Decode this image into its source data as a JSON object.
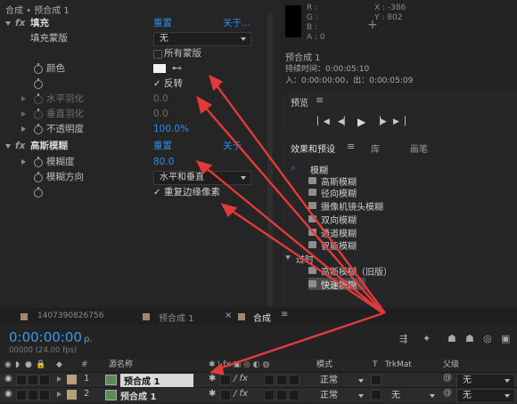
{
  "header": {
    "title": "合成 • 预合成 1"
  },
  "effects": {
    "fill": {
      "fx": "fx",
      "name": "填充",
      "reset": "重置",
      "about": "关于..."
    },
    "fill_mask": {
      "label": "填充蒙版",
      "value": "无"
    },
    "all_masks": {
      "label": "所有蒙版"
    },
    "color": {
      "label": "颜色"
    },
    "invert": {
      "check": "✓",
      "label": "反转"
    },
    "h_feather": {
      "label": "水平羽化",
      "value": "0.0"
    },
    "v_feather": {
      "label": "垂直羽化",
      "value": "0.0"
    },
    "opacity": {
      "label": "不透明度",
      "value": "100.0%"
    },
    "blur": {
      "fx": "fx",
      "name": "高斯模糊",
      "reset": "重置",
      "about": "关于"
    },
    "blurriness": {
      "label": "模糊度",
      "value": "80.0"
    },
    "blur_dir": {
      "label": "模糊方向",
      "value": "水平和垂直"
    },
    "repeat_edge": {
      "check": "✓",
      "label": "重复边缘像素"
    }
  },
  "info": {
    "r": "R :",
    "g": "G :",
    "b": "B :",
    "a": "A : 0",
    "x": "X : -386",
    "y": "Y : 802",
    "plus": "+",
    "comp_name": "预合成 1",
    "duration": "持续时间：0:00:05:10",
    "inout": "入：0:00:00:00，出：0:00:05:09"
  },
  "preview": {
    "title": "预览",
    "menu": "≡"
  },
  "effects_presets": {
    "tabs": [
      "效果和预设",
      "≡",
      "库",
      "画笔"
    ],
    "search_value": "模糊",
    "items": [
      "高斯模糊",
      "径向模糊",
      "摄像机镜头模糊",
      "双向模糊",
      "通道模糊",
      "智能模糊"
    ],
    "folder": "过时",
    "folder_items": [
      "高斯模糊（旧版）",
      "快速模糊"
    ]
  },
  "timeline": {
    "tabs": [
      "1407390826756",
      "预合成 1",
      "×",
      "合成",
      "≡"
    ],
    "timecode": "0:00:00:00",
    "fps": "00000 (24.00 fps)",
    "search_placeholder": "ρ.",
    "col_num": "#",
    "col_source": "源名称",
    "col_mode": "模式",
    "col_t": "T",
    "col_trkmat": "TrkMat",
    "col_parent": "父级",
    "layers": [
      {
        "num": "1",
        "name": "预合成 1",
        "mode": "正常",
        "trkmat": "",
        "parent": "无"
      },
      {
        "num": "2",
        "name": "预合成 1",
        "mode": "正常",
        "trkmat": "无",
        "parent": "无"
      }
    ]
  },
  "colors": {
    "accent": "#2d8ceb",
    "arrow": "#e23a3a"
  }
}
